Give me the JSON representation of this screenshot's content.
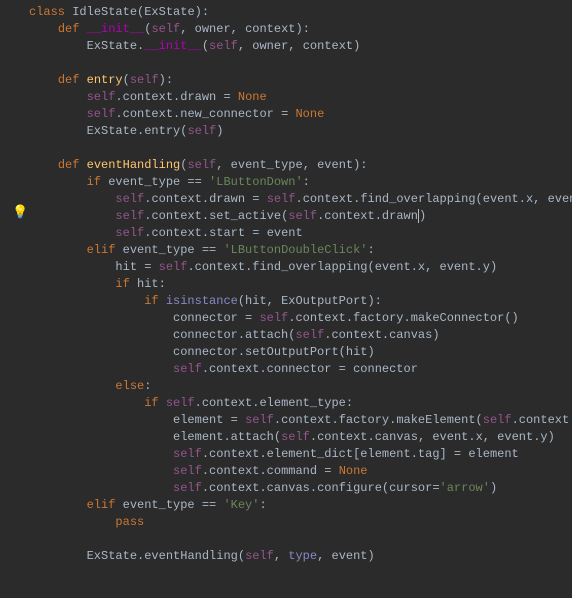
{
  "gutter": {
    "bulb_icon": "💡"
  },
  "kw": {
    "class": "class",
    "def": "def",
    "if": "if",
    "elif": "elif",
    "else": "else",
    "pass": "pass",
    "None": "None"
  },
  "bi": {
    "isinstance": "isinstance",
    "type": "type"
  },
  "self": "self",
  "special": {
    "init": "__init__"
  },
  "fn": {
    "entry": "entry",
    "eventHandling": "eventHandling"
  },
  "id": {
    "IdleState": "IdleState",
    "ExState": "ExState",
    "owner": "owner",
    "context": "context",
    "event_type": "event_type",
    "event": "event",
    "drawn": "drawn",
    "new_connector": "new_connector",
    "find_overlapping": "find_overlapping",
    "x": "x",
    "y": "y",
    "set_active": "set_active",
    "start": "start",
    "hit": "hit",
    "ExOutputPort": "ExOutputPort",
    "connector": "connector",
    "factory": "factory",
    "makeConnector": "makeConnector",
    "attach": "attach",
    "canvas": "canvas",
    "setOutputPort": "setOutputPort",
    "element_type": "element_type",
    "element": "element",
    "makeElement": "makeElement",
    "element_dict": "element_dict",
    "tag": "tag",
    "command": "command",
    "configure": "configure",
    "cursor": "cursor"
  },
  "str": {
    "LButtonDown": "'LButtonDown'",
    "LButtonDoubleClick": "'LButtonDoubleClick'",
    "Key": "'Key'",
    "arrow": "'arrow'"
  }
}
